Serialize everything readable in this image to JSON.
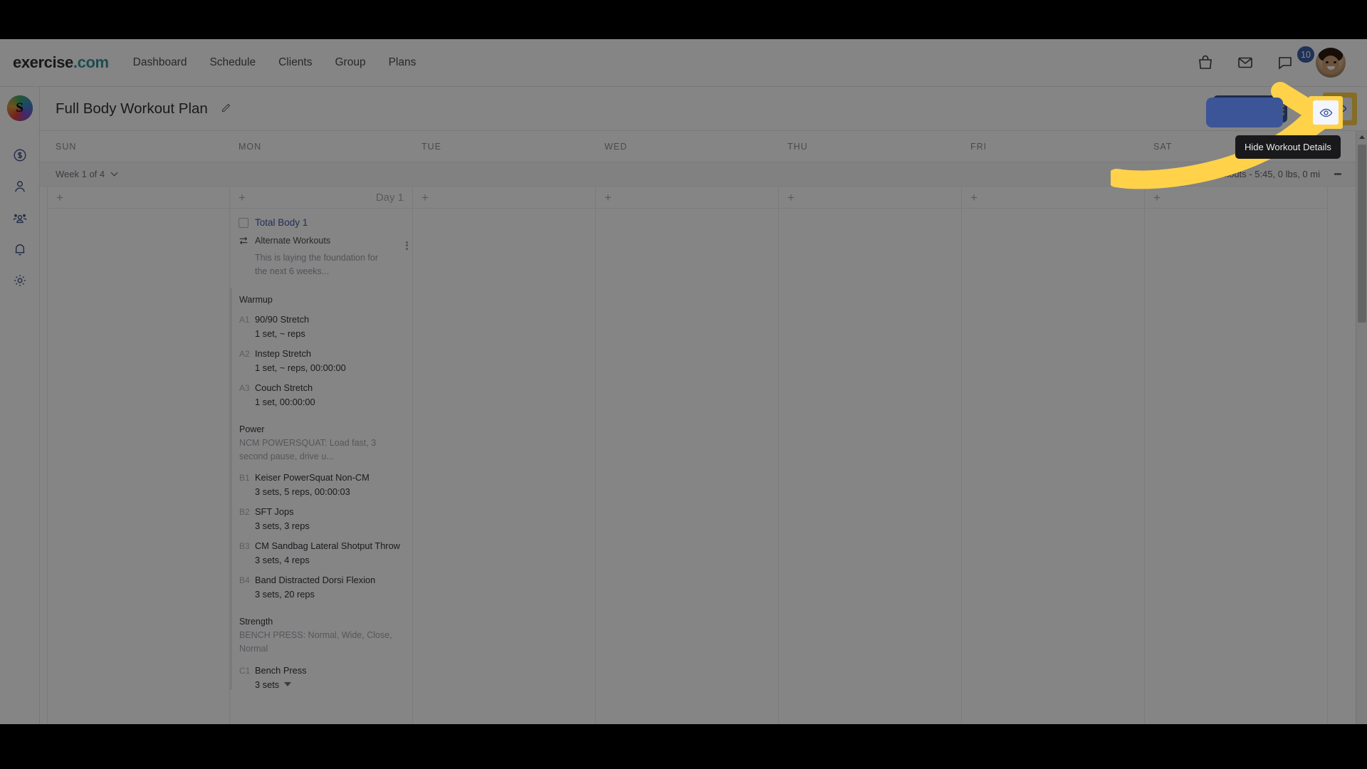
{
  "topnav": {
    "brand_main": "exercise",
    "brand_suffix": ".com",
    "links": [
      {
        "label": "Dashboard"
      },
      {
        "label": "Schedule"
      },
      {
        "label": "Clients"
      },
      {
        "label": "Group"
      },
      {
        "label": "Plans"
      }
    ],
    "icons": [
      {
        "name": "shopping-bag-icon"
      },
      {
        "name": "envelope-icon"
      },
      {
        "name": "chat-bubble-icon"
      }
    ],
    "chat_badge_count": "10"
  },
  "sidebar": {
    "logo_mark": "S",
    "items": [
      {
        "name": "billing-icon"
      },
      {
        "name": "user-icon"
      },
      {
        "name": "group-icon"
      },
      {
        "name": "bell-icon"
      },
      {
        "name": "gear-icon"
      }
    ]
  },
  "header": {
    "title": "Full Body Workout Plan",
    "edit_icon": "pencil-icon",
    "kebab_icon": "more-vertical-icon",
    "eye_icon": "eye-icon"
  },
  "tooltip": {
    "text": "Hide Workout Details"
  },
  "calendar": {
    "days": [
      "SUN",
      "MON",
      "TUE",
      "WED",
      "THU",
      "FRI",
      "SAT"
    ],
    "week_label": "Week 1 of 4",
    "week_summary": "1 Workouts - 5:45, 0 lbs, 0 mi",
    "add_symbol": "+",
    "day_number_label": "Day 1"
  },
  "workout": {
    "name": "Total Body 1",
    "alternate_label": "Alternate Workouts",
    "description": "This is laying the foundation for the next 6 weeks...",
    "sections": [
      {
        "title": "Warmup",
        "note": "",
        "exercises": [
          {
            "tag": "A1",
            "name": "90/90 Stretch",
            "detail": "1 set, ~ reps"
          },
          {
            "tag": "A2",
            "name": "Instep Stretch",
            "detail": "1 set, ~ reps, 00:00:00"
          },
          {
            "tag": "A3",
            "name": "Couch Stretch",
            "detail": "1 set, 00:00:00"
          }
        ]
      },
      {
        "title": "Power",
        "note": "NCM POWERSQUAT: Load fast, 3 second pause, drive u...",
        "exercises": [
          {
            "tag": "B1",
            "name": "Keiser PowerSquat Non-CM",
            "detail": "3 sets, 5 reps, 00:00:03"
          },
          {
            "tag": "B2",
            "name": "SFT Jops",
            "detail": "3 sets, 3 reps"
          },
          {
            "tag": "B3",
            "name": "CM Sandbag Lateral Shotput Throw",
            "detail": "3 sets, 4 reps"
          },
          {
            "tag": "B4",
            "name": "Band Distracted Dorsi Flexion",
            "detail": "3 sets, 20 reps"
          }
        ]
      },
      {
        "title": "Strength",
        "note": "BENCH PRESS: Normal, Wide, Close, Normal",
        "exercises": [
          {
            "tag": "C1",
            "name": "Bench Press",
            "detail": "3 sets",
            "has_caret": true
          }
        ]
      }
    ]
  },
  "colors": {
    "brand_teal": "#37939b",
    "accent_blue": "#3b5596",
    "link_blue": "#4358a8",
    "highlight_yellow": "#FFD24A",
    "tooltip_bg": "#19191b"
  }
}
